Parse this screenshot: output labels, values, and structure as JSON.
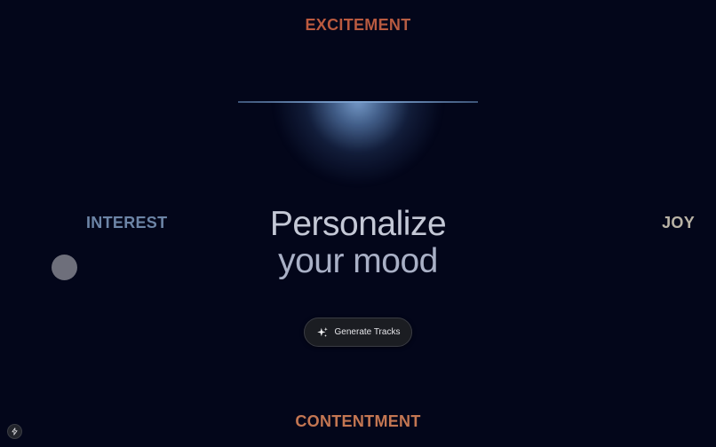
{
  "moods": {
    "top": "EXCITEMENT",
    "bottom": "CONTENTMENT",
    "left": "INTEREST",
    "right": "JOY"
  },
  "headline": {
    "line1": "Personalize",
    "line2": "your mood"
  },
  "generate_button": {
    "label": "Generate Tracks",
    "icon": "sparkle-icon"
  },
  "corner_badge": {
    "icon": "bolt-icon"
  },
  "colors": {
    "background": "#03061a",
    "excitement": "#c8593a",
    "contentment": "#c47652",
    "interest": "#6c84a6",
    "joy": "#b9b3a6",
    "glow": "#7ea3d0",
    "orb": "#6e6f7b"
  }
}
